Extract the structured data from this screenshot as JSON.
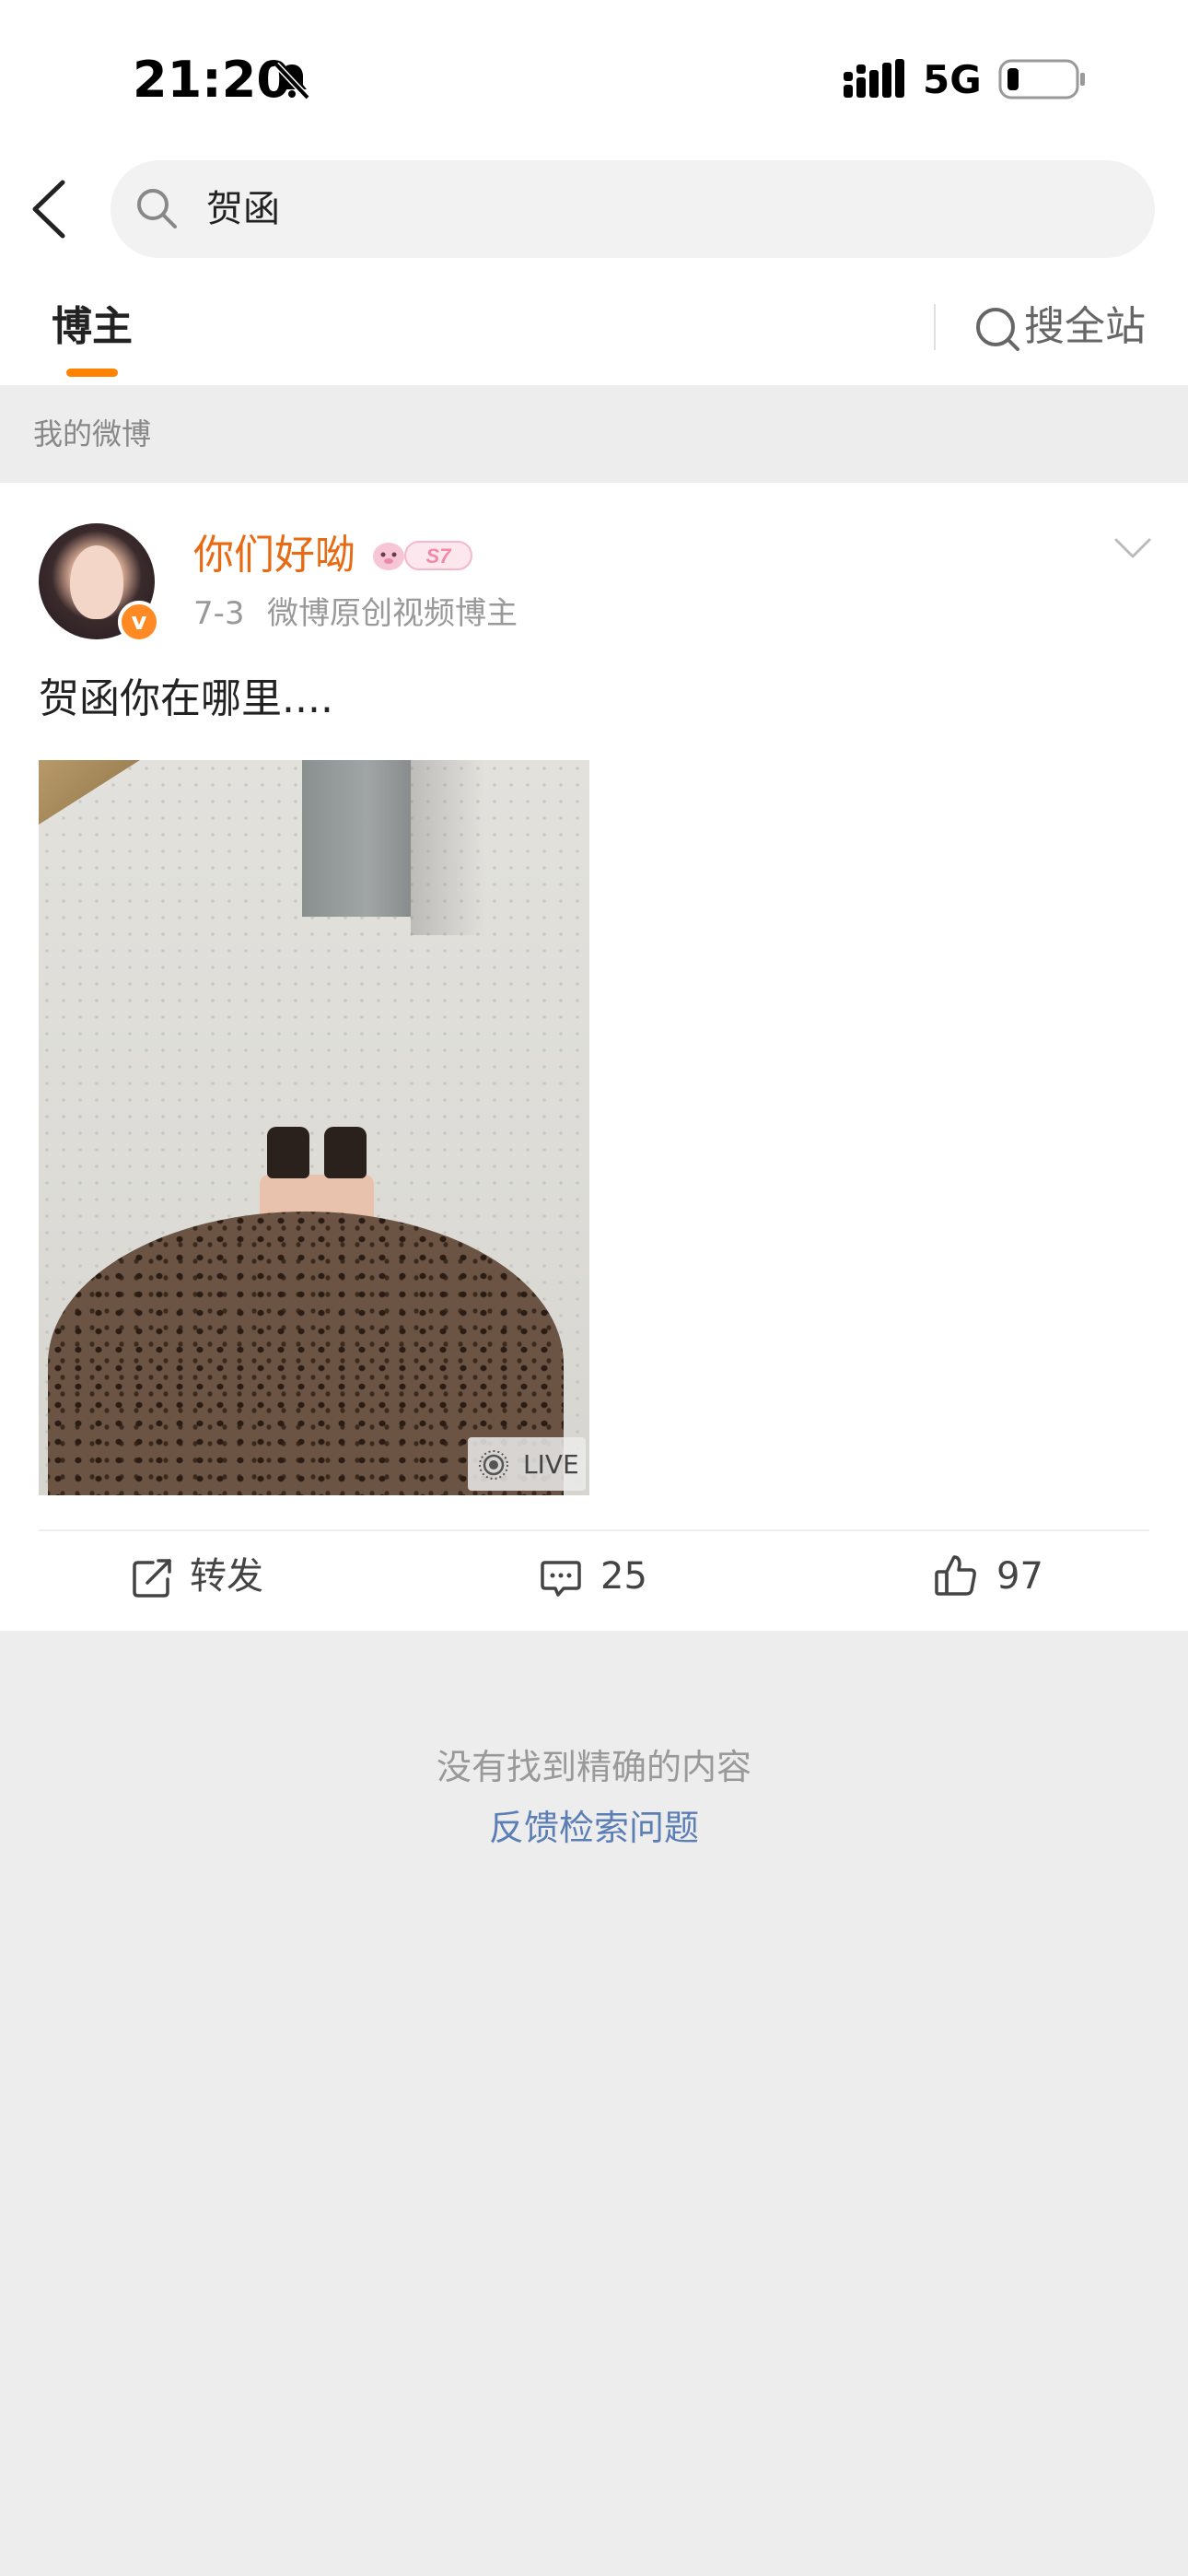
{
  "status_bar": {
    "time": "21:20",
    "network": "5G",
    "icons": [
      "bell-slash-icon",
      "signal-icon",
      "battery-icon"
    ]
  },
  "search": {
    "value": "贺函"
  },
  "tabs": {
    "active": "博主",
    "search_all": "搜全站"
  },
  "section": {
    "title": "我的微博"
  },
  "post": {
    "author": "你们好呦",
    "level_badge": "S7",
    "date": "7-3",
    "source": "微博原创视频博主",
    "text": "贺函你在哪里....",
    "photo_badge": "LIVE",
    "actions": {
      "repost": "转发",
      "comments": "25",
      "likes": "97"
    }
  },
  "empty_state": {
    "message": "没有找到精确的内容",
    "feedback": "反馈检索问题"
  },
  "colors": {
    "accent": "#ff8200",
    "author_name": "#e86b14",
    "link": "#5b7eb5",
    "background": "#ededed"
  }
}
